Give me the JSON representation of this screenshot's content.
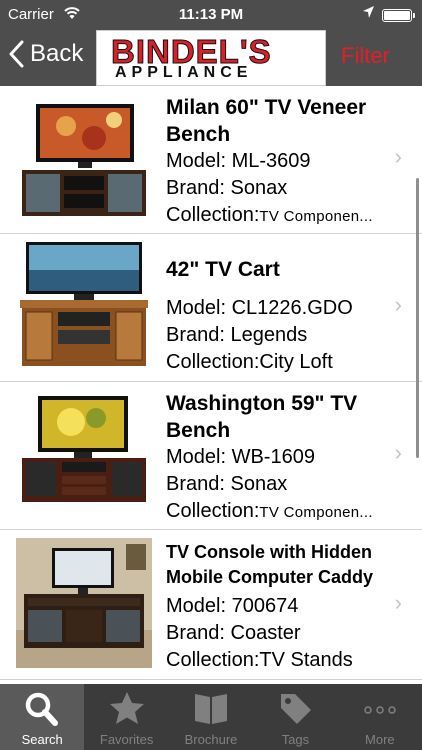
{
  "status_bar": {
    "carrier": "Carrier",
    "time": "11:13 PM"
  },
  "nav": {
    "back_label": "Back",
    "logo_line1": "BINDEL'S",
    "logo_line2": "APPLIANCE",
    "filter_label": "Filter"
  },
  "products": [
    {
      "title": "Milan 60\" TV Veneer Bench",
      "model_label": "Model:",
      "model": "ML-3609",
      "brand_label": "Brand:",
      "brand": "Sonax",
      "collection_label": "Collection:",
      "collection": "TV Componen..."
    },
    {
      "title": "42\" TV Cart",
      "model_label": "Model:",
      "model": "CL1226.GDO",
      "brand_label": "Brand:",
      "brand": "Legends",
      "collection_label": "Collection:",
      "collection": "City Loft"
    },
    {
      "title": "Washington 59\" TV Bench",
      "model_label": "Model:",
      "model": "WB-1609",
      "brand_label": "Brand:",
      "brand": "Sonax",
      "collection_label": "Collection:",
      "collection": "TV Componen..."
    },
    {
      "title": "TV Console with Hidden Mobile Computer Caddy",
      "model_label": "Model:",
      "model": "700674",
      "brand_label": "Brand:",
      "brand": "Coaster",
      "collection_label": "Collection:",
      "collection": "TV Stands"
    }
  ],
  "tabs": [
    {
      "label": "Search",
      "icon": "search-icon",
      "active": true
    },
    {
      "label": "Favorites",
      "icon": "star-icon",
      "active": false
    },
    {
      "label": "Brochure",
      "icon": "brochure-icon",
      "active": false
    },
    {
      "label": "Tags",
      "icon": "tag-icon",
      "active": false
    },
    {
      "label": "More",
      "icon": "more-icon",
      "active": false
    }
  ],
  "colors": {
    "bar_bg": "#4d4d4d",
    "tab_bg": "#3b3b3b",
    "accent_red": "#e51e25"
  }
}
